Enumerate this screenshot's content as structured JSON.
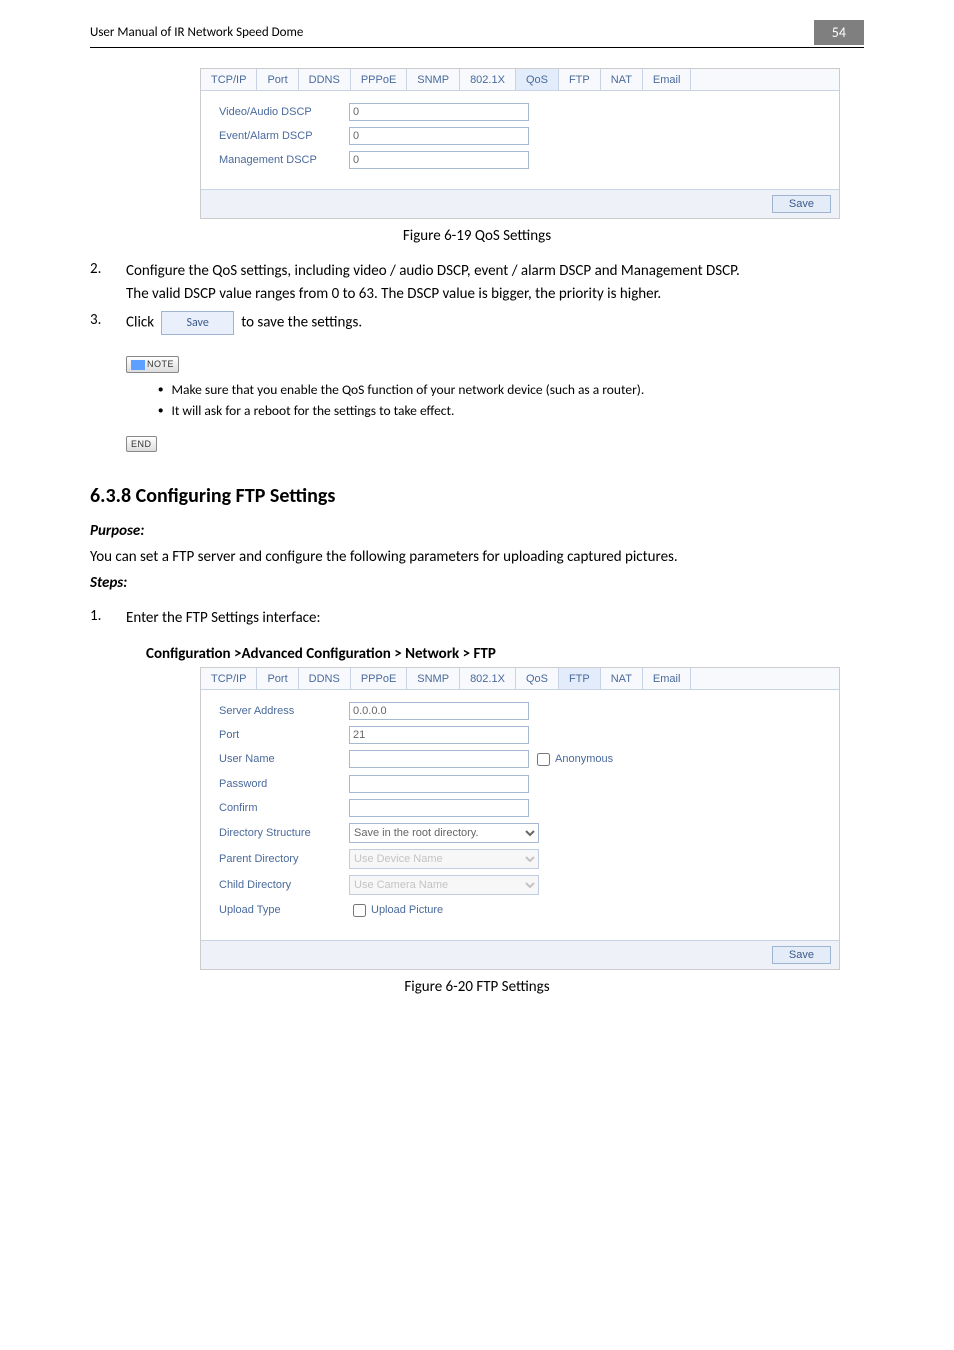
{
  "header": {
    "title": "User Manual of IR Network Speed Dome",
    "page": "54"
  },
  "qos_tabs": [
    "TCP/IP",
    "Port",
    "DDNS",
    "PPPoE",
    "SNMP",
    "802.1X",
    "QoS",
    "FTP",
    "NAT",
    "Email"
  ],
  "qos_active_tab": "QoS",
  "qos_fields": {
    "video_label": "Video/Audio DSCP",
    "video_val": "0",
    "event_label": "Event/Alarm DSCP",
    "event_val": "0",
    "mgmt_label": "Management DSCP",
    "mgmt_val": "0"
  },
  "save_btn": "Save",
  "caption_qos": "Figure 6-19 QoS Settings",
  "step2_num": "2.",
  "step2_a": "Configure the QoS settings, including video / audio DSCP, event / alarm DSCP and Management DSCP.",
  "step2_b": "The valid DSCP value ranges from 0 to 63. The DSCP value is bigger, the priority is higher.",
  "step3_num": "3.",
  "step3_pre": "Click",
  "step3_btn": "Save",
  "step3_post": "to save the settings.",
  "note_label": "NOTE",
  "note1": "Make sure that you enable the QoS function of your network device (such as a router).",
  "note2": "It will ask for a reboot for the settings to take effect.",
  "end_label": "END",
  "section_heading": "6.3.8  Configuring FTP Settings",
  "purpose_label": "Purpose:",
  "purpose_text": "You can set a FTP server and configure the following parameters for uploading captured pictures.",
  "steps_label": "Steps:",
  "step1_num": "1.",
  "step1_text": "Enter the FTP Settings interface:",
  "config_path": "Configuration >Advanced Configuration > Network > FTP",
  "ftp_tabs": [
    "TCP/IP",
    "Port",
    "DDNS",
    "PPPoE",
    "SNMP",
    "802.1X",
    "QoS",
    "FTP",
    "NAT",
    "Email"
  ],
  "ftp_active_tab": "FTP",
  "ftp": {
    "server_label": "Server Address",
    "server_val": "0.0.0.0",
    "port_label": "Port",
    "port_val": "21",
    "user_label": "User Name",
    "user_val": "",
    "anon_label": "Anonymous",
    "pass_label": "Password",
    "pass_val": "",
    "confirm_label": "Confirm",
    "confirm_val": "",
    "dir_label": "Directory Structure",
    "dir_val": "Save in the root directory.",
    "parent_label": "Parent Directory",
    "parent_val": "Use Device Name",
    "child_label": "Child Directory",
    "child_val": "Use Camera Name",
    "upload_label": "Upload Type",
    "upload_chk_label": "Upload Picture"
  },
  "caption_ftp": "Figure 6-20 FTP Settings"
}
